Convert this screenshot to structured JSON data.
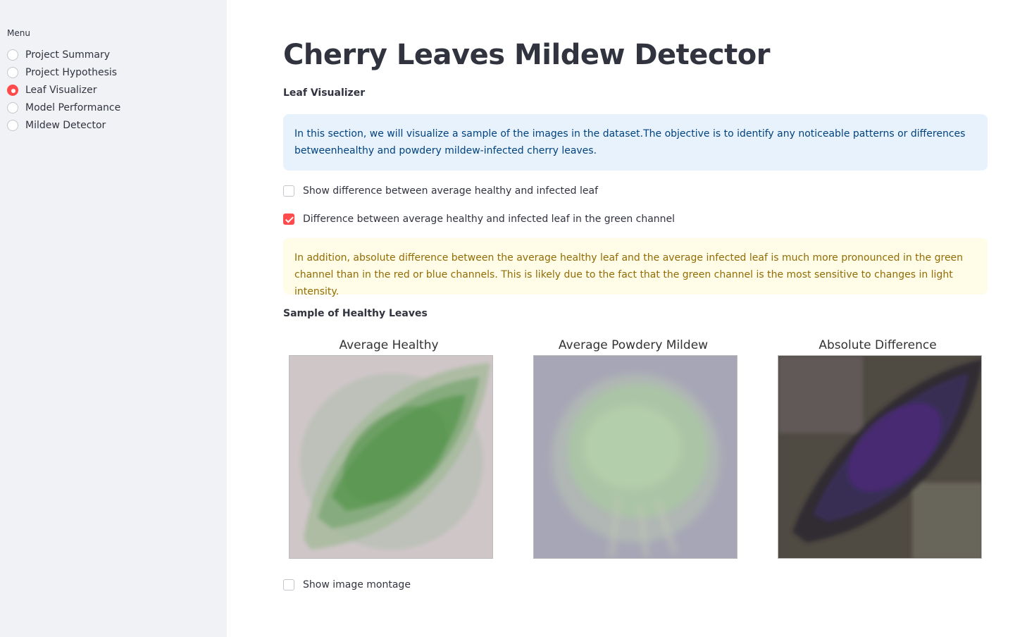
{
  "sidebar": {
    "menu_label": "Menu",
    "items": [
      {
        "label": "Project Summary",
        "selected": false
      },
      {
        "label": "Project Hypothesis",
        "selected": false
      },
      {
        "label": "Leaf Visualizer",
        "selected": true
      },
      {
        "label": "Model Performance",
        "selected": false
      },
      {
        "label": "Mildew Detector",
        "selected": false
      }
    ]
  },
  "main": {
    "title": "Cherry Leaves Mildew Detector",
    "subtitle": "Leaf Visualizer",
    "info_text": "In this section, we will visualize a sample of the images in the dataset.The objective is to identify any noticeable patterns or differences betweenhealthy and powdery mildew-infected cherry leaves.",
    "checkbox_diff": {
      "label": "Show difference between average healthy and infected leaf",
      "checked": false
    },
    "checkbox_green": {
      "label": "Difference between average healthy and infected leaf in the green channel",
      "checked": true
    },
    "warning_text": "In addition, absolute difference between the average healthy leaf and the average infected leaf is much more pronounced in the green channel than in the red or blue channels. This is likely due to the fact that the green channel is the most sensitive to changes in light intensity.",
    "sample_heading": "Sample of Healthy Leaves",
    "figures": [
      {
        "title": "Average Healthy"
      },
      {
        "title": "Average Powdery Mildew"
      },
      {
        "title": "Absolute Difference"
      }
    ],
    "checkbox_montage": {
      "label": "Show image montage",
      "checked": false
    }
  },
  "colors": {
    "accent": "#ff4b4b",
    "sidebar_bg": "#f0f2f6",
    "info_text": "#004280",
    "warning_text": "#926c05"
  }
}
